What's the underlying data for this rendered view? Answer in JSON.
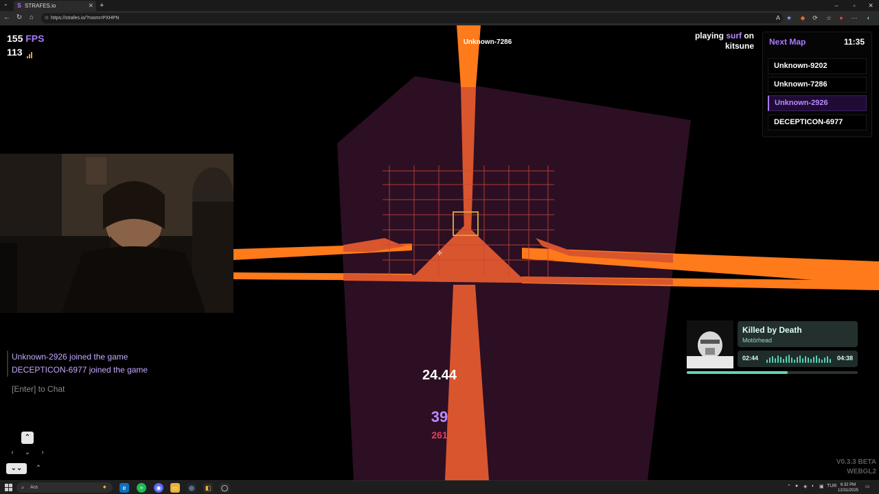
{
  "browser": {
    "tab_title": "STRAFES.io",
    "tab_favicon": "S",
    "url": "https://strafes.io/?room=PXHPN"
  },
  "hud": {
    "fps_value": "155",
    "fps_unit": "FPS",
    "ping_value": "113",
    "player_nametag": "Unknown-7286",
    "playing_prefix": "playing",
    "playing_mode": "surf",
    "playing_on": "on",
    "playing_map": "kitsune",
    "timer": "24.44",
    "speed": "39",
    "speed_secondary": "261",
    "version_line1": "V0.3.3 BETA",
    "version_line2": "WEBGL2"
  },
  "map_panel": {
    "title": "Next Map",
    "time": "11:35",
    "players": [
      {
        "name": "Unknown-9202",
        "selected": false
      },
      {
        "name": "Unknown-7286",
        "selected": false
      },
      {
        "name": "Unknown-2926",
        "selected": true
      },
      {
        "name": "DECEPTICON-6977",
        "selected": false
      }
    ]
  },
  "chat": {
    "messages": [
      "Unknown-2926 joined the game",
      "DECEPTICON-6977 joined the game"
    ],
    "hint": "[Enter] to Chat"
  },
  "music": {
    "song": "Killed by Death",
    "artist": "Motörhead",
    "elapsed": "02:44",
    "duration": "04:38",
    "progress_fraction": 0.59
  },
  "taskbar": {
    "search_placeholder": "Ara",
    "lang": "TUR",
    "time": "6:32 PM",
    "date": "12/31/2025"
  },
  "colors": {
    "accent_purple": "#a77bff",
    "orange_beam": "#ff7a1a",
    "purple_wall": "#2c0f23",
    "teal_music": "#5fd6b9"
  }
}
